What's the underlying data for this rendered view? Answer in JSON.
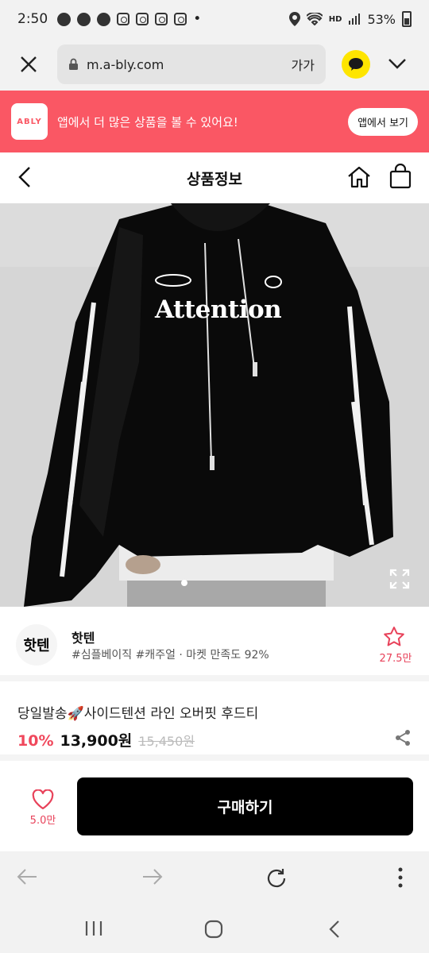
{
  "status_bar": {
    "time": "2:50",
    "notification_icons": [
      "chat-icon",
      "chat-icon",
      "talk-icon",
      "instagram-icon",
      "instagram-icon",
      "instagram-icon",
      "instagram-icon"
    ],
    "more_dot": "•",
    "network_label": "HD",
    "battery": "53%"
  },
  "browser": {
    "url": "m.a-bly.com",
    "text_size_label": "가가"
  },
  "app_banner": {
    "logo_text": "ABLY",
    "message": "앱에서 더 많은 상품을 볼 수 있어요!",
    "button_label": "앱에서 보기",
    "color": "#fa5764"
  },
  "header": {
    "title": "상품정보"
  },
  "product_image": {
    "print_text": "Attention",
    "slide_index": 1
  },
  "shop": {
    "logo_text": "핫텐",
    "name": "핫텐",
    "tags": "#심플베이직 #캐주얼 · 마켓 만족도 92%",
    "likes": "27.5만"
  },
  "product": {
    "name": "당일발송🚀사이드텐션 라인 오버핏 후드티",
    "discount": "10%",
    "price": "13,900원",
    "original_price": "15,450원"
  },
  "purchase": {
    "like_count": "5.0만",
    "buy_label": "구매하기"
  },
  "colors": {
    "accent": "#fa5764",
    "price_accent": "#f0485c"
  }
}
